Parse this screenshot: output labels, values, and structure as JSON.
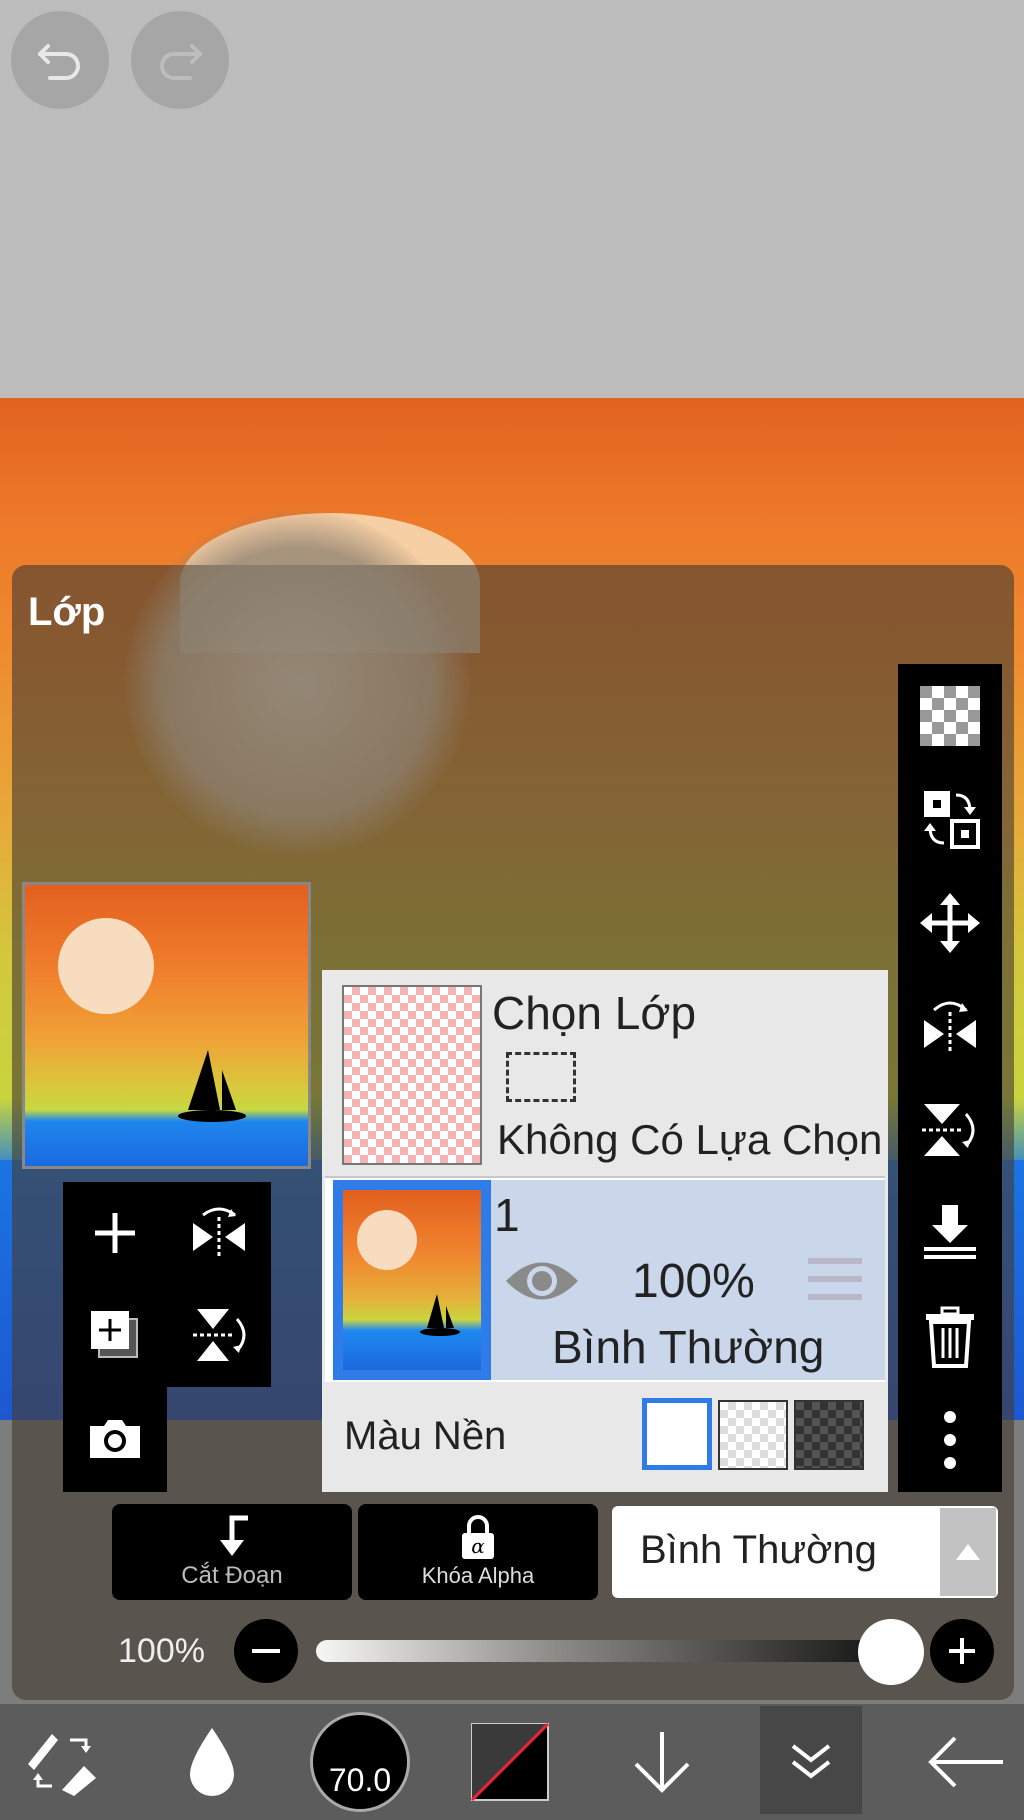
{
  "panel": {
    "title": "Lớp"
  },
  "layers": {
    "selection_layer": {
      "title": "Chọn Lớp",
      "status": "Không Có Lựa Chọn"
    },
    "layer_1": {
      "name": "1",
      "opacity": "100%",
      "blend_mode": "Bình Thường"
    },
    "background": {
      "label": "Màu Nền"
    }
  },
  "actions": {
    "clipping_label": "Cắt Đoạn",
    "alpha_lock_label": "Khóa Alpha",
    "blend_mode_value": "Bình Thường"
  },
  "opacity_slider": {
    "label": "100%",
    "value_fraction": 1.0
  },
  "bottom_toolbar": {
    "brush_size": "70.0"
  },
  "icons": {
    "undo": "undo-icon",
    "redo": "redo-icon",
    "add_layer": "plus-icon",
    "duplicate": "copy-layer-icon",
    "camera": "camera-icon",
    "flip_h": "flip-horizontal-icon",
    "flip_v": "flip-vertical-icon",
    "right_tools": [
      "checker-icon",
      "swap-layers-icon",
      "move-icon",
      "flip-horizontal-icon",
      "flip-vertical-icon",
      "merge-down-icon",
      "trash-icon",
      "more-icon"
    ]
  },
  "colors": {
    "accent": "#2f7be8",
    "selected_row": "#cad6ea"
  }
}
